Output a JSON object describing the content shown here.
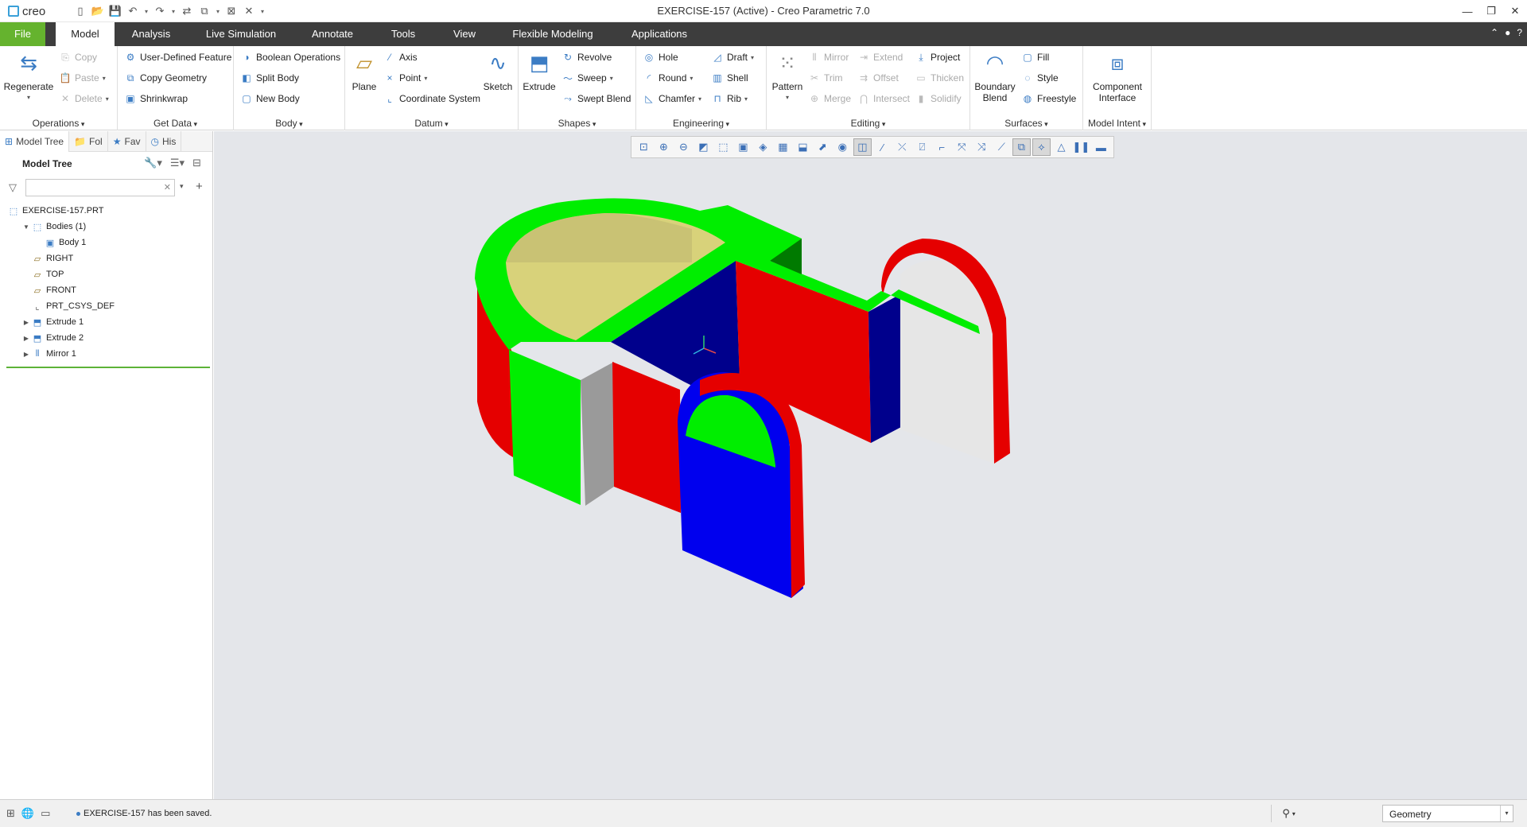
{
  "app": {
    "logo": "creo",
    "title": "EXERCISE-157 (Active) - Creo Parametric 7.0"
  },
  "tabs": [
    "File",
    "Model",
    "Analysis",
    "Live Simulation",
    "Annotate",
    "Tools",
    "View",
    "Flexible Modeling",
    "Applications"
  ],
  "ribbon": {
    "operations": {
      "label": "Operations",
      "regenerate": "Regenerate",
      "copy": "Copy",
      "paste": "Paste",
      "delete": "Delete"
    },
    "get_data": {
      "label": "Get Data",
      "udf": "User-Defined Feature",
      "copy_geometry": "Copy Geometry",
      "shrinkwrap": "Shrinkwrap"
    },
    "body": {
      "label": "Body",
      "boolean": "Boolean Operations",
      "split": "Split Body",
      "new": "New Body"
    },
    "datum": {
      "label": "Datum",
      "plane": "Plane",
      "axis": "Axis",
      "point": "Point",
      "csys": "Coordinate System",
      "sketch": "Sketch"
    },
    "shapes": {
      "label": "Shapes",
      "extrude": "Extrude",
      "revolve": "Revolve",
      "sweep": "Sweep",
      "swept_blend": "Swept Blend"
    },
    "engineering": {
      "label": "Engineering",
      "hole": "Hole",
      "round": "Round",
      "chamfer": "Chamfer",
      "draft": "Draft",
      "shell": "Shell",
      "rib": "Rib"
    },
    "editing": {
      "label": "Editing",
      "pattern": "Pattern",
      "mirror": "Mirror",
      "trim": "Trim",
      "merge": "Merge",
      "extend": "Extend",
      "offset": "Offset",
      "intersect": "Intersect",
      "project": "Project",
      "thicken": "Thicken",
      "solidify": "Solidify"
    },
    "surfaces": {
      "label": "Surfaces",
      "boundary_blend": "Boundary Blend",
      "fill": "Fill",
      "style": "Style",
      "freestyle": "Freestyle"
    },
    "model_intent": {
      "label": "Model Intent",
      "component_interface": "Component Interface"
    }
  },
  "panel": {
    "tabs": [
      "Model Tree",
      "Fol",
      "Fav",
      "His"
    ],
    "title": "Model Tree",
    "search_value": "",
    "tree": [
      {
        "label": "EXERCISE-157.PRT",
        "icon": "part-icon",
        "level": 0,
        "expand": ""
      },
      {
        "label": "Bodies (1)",
        "icon": "bodies-icon",
        "level": 1,
        "expand": "▼"
      },
      {
        "label": "Body 1",
        "icon": "body-icon",
        "level": 2,
        "expand": ""
      },
      {
        "label": "RIGHT",
        "icon": "datum-plane-icon",
        "level": 1,
        "expand": ""
      },
      {
        "label": "TOP",
        "icon": "datum-plane-icon",
        "level": 1,
        "expand": ""
      },
      {
        "label": "FRONT",
        "icon": "datum-plane-icon",
        "level": 1,
        "expand": ""
      },
      {
        "label": "PRT_CSYS_DEF",
        "icon": "csys-icon",
        "level": 1,
        "expand": ""
      },
      {
        "label": "Extrude 1",
        "icon": "extrude-icon",
        "level": 1,
        "expand": "▶"
      },
      {
        "label": "Extrude 2",
        "icon": "extrude-icon",
        "level": 1,
        "expand": "▶"
      },
      {
        "label": "Mirror 1",
        "icon": "mirror-icon",
        "level": 1,
        "expand": "▶"
      }
    ]
  },
  "status": {
    "message": "EXERCISE-157 has been saved.",
    "filter_value": "Geometry"
  },
  "colors": {
    "file_tab": "#65b32e",
    "tab_bar": "#3d3d3d",
    "viewport": "#e4e6ea",
    "face_green": "#00ee00",
    "face_red": "#e50000",
    "face_blue": "#0000ee",
    "face_navy": "#00008c",
    "face_white": "#e6e6e6",
    "face_yellow": "#d8d27a"
  }
}
